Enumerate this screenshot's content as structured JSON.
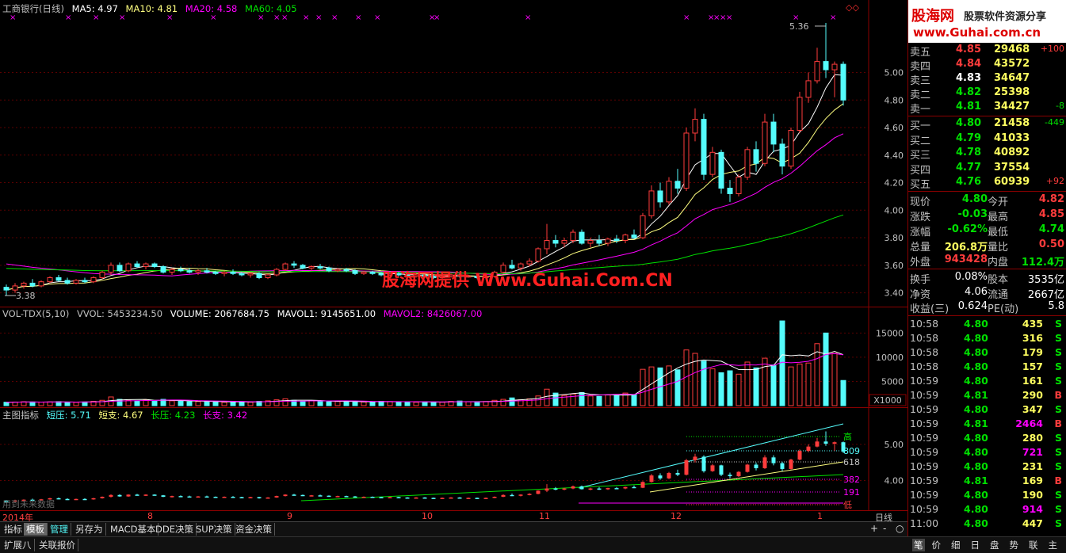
{
  "header": {
    "title": "工商银行(日线)",
    "ma5": "MA5: 4.97",
    "ma10": "MA10: 4.81",
    "ma20": "MA20: 4.58",
    "ma60": "MA60: 4.05"
  },
  "main_chart": {
    "high_label": "5.36",
    "low_label": "3.38",
    "y_ticks": [
      "5.00",
      "4.80",
      "4.60",
      "4.40",
      "4.20",
      "4.00",
      "3.80",
      "3.60",
      "3.40"
    ],
    "watermark": "股海网提供 Www.Guhai.Com.CN"
  },
  "vol_header": {
    "name": "VOL-TDX(5,10)",
    "vvol": "VVOL: 5453234.50",
    "volume": "VOLUME: 2067684.75",
    "mavol1": "MAVOL1: 9145651.00",
    "mavol2": "MAVOL2: 8426067.00"
  },
  "vol_axis": {
    "ticks": [
      "15000",
      "10000",
      "5000"
    ],
    "unit": "X1000"
  },
  "ind_header": {
    "name": "主图指标",
    "short_press": "短压: 5.71",
    "short_support": "短支: 4.67",
    "long_press": "长压: 4.23",
    "long_support": "长支: 3.42"
  },
  "ind_axis": {
    "ticks": [
      "5.00",
      "4.00"
    ],
    "labels": [
      "高",
      "809",
      "618",
      "382",
      "191",
      "低"
    ]
  },
  "ind_note": "用到未来数据",
  "date_axis": {
    "year": "2014年",
    "months": [
      "8",
      "9",
      "10",
      "11",
      "12",
      "1"
    ]
  },
  "period": "日线",
  "tabs": [
    "指标",
    "模板",
    "管理",
    "另存为",
    "MACD基本",
    "DDE决策",
    "SUP决策",
    "资金决策"
  ],
  "tabs2": [
    "扩展八",
    "关联报价"
  ],
  "logo": {
    "name": "股海网",
    "slogan": "股票软件资源分享",
    "url": "www.Guhai.com.cn"
  },
  "order_book": {
    "sell": [
      {
        "label": "卖五",
        "price": "4.85",
        "vol": "29468",
        "chg": "+100"
      },
      {
        "label": "卖四",
        "price": "4.84",
        "vol": "43572",
        "chg": ""
      },
      {
        "label": "卖三",
        "price": "4.83",
        "vol": "34647",
        "chg": ""
      },
      {
        "label": "卖二",
        "price": "4.82",
        "vol": "25398",
        "chg": ""
      },
      {
        "label": "卖一",
        "price": "4.81",
        "vol": "34427",
        "chg": "-8"
      }
    ],
    "buy": [
      {
        "label": "买一",
        "price": "4.80",
        "vol": "21458",
        "chg": "-449"
      },
      {
        "label": "买二",
        "price": "4.79",
        "vol": "41033",
        "chg": ""
      },
      {
        "label": "买三",
        "price": "4.78",
        "vol": "40892",
        "chg": ""
      },
      {
        "label": "买四",
        "price": "4.77",
        "vol": "37554",
        "chg": ""
      },
      {
        "label": "买五",
        "price": "4.76",
        "vol": "60939",
        "chg": "+92"
      }
    ]
  },
  "stats": [
    {
      "l1": "现价",
      "v1": "4.80",
      "l2": "今开",
      "v2": "4.82"
    },
    {
      "l1": "涨跌",
      "v1": "-0.03",
      "l2": "最高",
      "v2": "4.85"
    },
    {
      "l1": "涨幅",
      "v1": "-0.62%",
      "l2": "最低",
      "v2": "4.74"
    },
    {
      "l1": "总量",
      "v1": "206.8万",
      "l2": "量比",
      "v2": "0.50"
    },
    {
      "l1": "外盘",
      "v1": "943428",
      "l2": "内盘",
      "v2": "112.4万"
    }
  ],
  "fund": [
    {
      "l1": "换手",
      "v1": "0.08%",
      "l2": "股本",
      "v2": "3535亿"
    },
    {
      "l1": "净资",
      "v1": "4.06",
      "l2": "流通",
      "v2": "2667亿"
    },
    {
      "l1": "收益(三)",
      "v1": "0.624",
      "l2": "PE(动)",
      "v2": "5.8"
    }
  ],
  "ticks": [
    {
      "t": "10:58",
      "p": "4.80",
      "v": "435",
      "s": "S"
    },
    {
      "t": "10:58",
      "p": "4.80",
      "v": "316",
      "s": "S"
    },
    {
      "t": "10:58",
      "p": "4.80",
      "v": "179",
      "s": "S"
    },
    {
      "t": "10:58",
      "p": "4.80",
      "v": "157",
      "s": "S"
    },
    {
      "t": "10:59",
      "p": "4.80",
      "v": "161",
      "s": "S"
    },
    {
      "t": "10:59",
      "p": "4.81",
      "v": "290",
      "s": "B"
    },
    {
      "t": "10:59",
      "p": "4.80",
      "v": "347",
      "s": "S"
    },
    {
      "t": "10:59",
      "p": "4.81",
      "v": "2464",
      "s": "B"
    },
    {
      "t": "10:59",
      "p": "4.80",
      "v": "280",
      "s": "S"
    },
    {
      "t": "10:59",
      "p": "4.80",
      "v": "721",
      "s": "S"
    },
    {
      "t": "10:59",
      "p": "4.80",
      "v": "231",
      "s": "S"
    },
    {
      "t": "10:59",
      "p": "4.81",
      "v": "169",
      "s": "B"
    },
    {
      "t": "10:59",
      "p": "4.80",
      "v": "190",
      "s": "S"
    },
    {
      "t": "10:59",
      "p": "4.80",
      "v": "914",
      "s": "S"
    },
    {
      "t": "11:00",
      "p": "4.80",
      "v": "447",
      "s": "S"
    }
  ],
  "right_tabs": [
    "笔",
    "价",
    "细",
    "日",
    "盘",
    "势",
    "联",
    "主"
  ],
  "colors": {
    "up": "#ff3c3c",
    "down": "#54fcfc",
    "ma5": "#ffffff",
    "ma10": "#ffff80",
    "ma20": "#ff00ff",
    "ma60": "#00e000"
  },
  "chart_data": {
    "type": "candlestick",
    "ylim": [
      3.34,
      5.4
    ],
    "candles": [
      [
        3.44,
        3.46,
        3.38,
        3.42
      ],
      [
        3.42,
        3.47,
        3.4,
        3.45
      ],
      [
        3.45,
        3.48,
        3.43,
        3.47
      ],
      [
        3.47,
        3.5,
        3.44,
        3.45
      ],
      [
        3.45,
        3.49,
        3.44,
        3.48
      ],
      [
        3.48,
        3.52,
        3.47,
        3.51
      ],
      [
        3.51,
        3.53,
        3.48,
        3.49
      ],
      [
        3.49,
        3.51,
        3.46,
        3.47
      ],
      [
        3.47,
        3.5,
        3.46,
        3.49
      ],
      [
        3.49,
        3.51,
        3.47,
        3.48
      ],
      [
        3.48,
        3.52,
        3.47,
        3.51
      ],
      [
        3.51,
        3.56,
        3.5,
        3.55
      ],
      [
        3.55,
        3.62,
        3.53,
        3.6
      ],
      [
        3.6,
        3.62,
        3.55,
        3.56
      ],
      [
        3.56,
        3.62,
        3.55,
        3.61
      ],
      [
        3.61,
        3.63,
        3.58,
        3.59
      ],
      [
        3.59,
        3.62,
        3.57,
        3.61
      ],
      [
        3.61,
        3.62,
        3.58,
        3.59
      ],
      [
        3.59,
        3.6,
        3.54,
        3.55
      ],
      [
        3.55,
        3.58,
        3.53,
        3.57
      ],
      [
        3.57,
        3.59,
        3.55,
        3.56
      ],
      [
        3.56,
        3.58,
        3.54,
        3.55
      ],
      [
        3.55,
        3.57,
        3.53,
        3.56
      ],
      [
        3.56,
        3.58,
        3.54,
        3.55
      ],
      [
        3.55,
        3.56,
        3.53,
        3.54
      ],
      [
        3.54,
        3.56,
        3.52,
        3.55
      ],
      [
        3.55,
        3.57,
        3.53,
        3.54
      ],
      [
        3.54,
        3.55,
        3.52,
        3.53
      ],
      [
        3.53,
        3.55,
        3.51,
        3.54
      ],
      [
        3.54,
        3.55,
        3.5,
        3.51
      ],
      [
        3.51,
        3.54,
        3.5,
        3.53
      ],
      [
        3.53,
        3.58,
        3.52,
        3.57
      ],
      [
        3.57,
        3.62,
        3.56,
        3.61
      ],
      [
        3.61,
        3.63,
        3.58,
        3.6
      ],
      [
        3.6,
        3.61,
        3.57,
        3.58
      ],
      [
        3.58,
        3.6,
        3.56,
        3.59
      ],
      [
        3.59,
        3.61,
        3.57,
        3.58
      ],
      [
        3.58,
        3.59,
        3.55,
        3.56
      ],
      [
        3.56,
        3.58,
        3.55,
        3.57
      ],
      [
        3.57,
        3.58,
        3.55,
        3.56
      ],
      [
        3.56,
        3.57,
        3.53,
        3.54
      ],
      [
        3.54,
        3.56,
        3.53,
        3.55
      ],
      [
        3.55,
        3.56,
        3.53,
        3.54
      ],
      [
        3.54,
        3.55,
        3.52,
        3.53
      ],
      [
        3.53,
        3.55,
        3.52,
        3.54
      ],
      [
        3.54,
        3.55,
        3.52,
        3.53
      ],
      [
        3.53,
        3.54,
        3.51,
        3.52
      ],
      [
        3.52,
        3.54,
        3.51,
        3.53
      ],
      [
        3.53,
        3.54,
        3.51,
        3.52
      ],
      [
        3.52,
        3.53,
        3.5,
        3.51
      ],
      [
        3.51,
        3.53,
        3.5,
        3.52
      ],
      [
        3.52,
        3.54,
        3.51,
        3.53
      ],
      [
        3.53,
        3.54,
        3.51,
        3.52
      ],
      [
        3.52,
        3.53,
        3.51,
        3.52
      ],
      [
        3.52,
        3.53,
        3.5,
        3.51
      ],
      [
        3.51,
        3.53,
        3.5,
        3.52
      ],
      [
        3.52,
        3.56,
        3.51,
        3.55
      ],
      [
        3.55,
        3.62,
        3.54,
        3.6
      ],
      [
        3.6,
        3.64,
        3.57,
        3.58
      ],
      [
        3.58,
        3.62,
        3.56,
        3.61
      ],
      [
        3.61,
        3.65,
        3.59,
        3.63
      ],
      [
        3.63,
        3.73,
        3.62,
        3.72
      ],
      [
        3.72,
        3.9,
        3.68,
        3.78
      ],
      [
        3.78,
        3.82,
        3.73,
        3.76
      ],
      [
        3.76,
        3.8,
        3.73,
        3.78
      ],
      [
        3.78,
        3.86,
        3.76,
        3.84
      ],
      [
        3.84,
        3.86,
        3.75,
        3.76
      ],
      [
        3.76,
        3.8,
        3.73,
        3.78
      ],
      [
        3.78,
        3.82,
        3.74,
        3.76
      ],
      [
        3.76,
        3.8,
        3.74,
        3.79
      ],
      [
        3.79,
        3.82,
        3.76,
        3.78
      ],
      [
        3.78,
        3.83,
        3.76,
        3.82
      ],
      [
        3.82,
        3.86,
        3.79,
        3.8
      ],
      [
        3.8,
        3.98,
        3.79,
        3.96
      ],
      [
        3.96,
        4.18,
        3.94,
        4.14
      ],
      [
        4.14,
        4.2,
        4.02,
        4.06
      ],
      [
        4.06,
        4.24,
        4.04,
        4.21
      ],
      [
        4.21,
        4.3,
        4.12,
        4.16
      ],
      [
        4.16,
        4.6,
        4.14,
        4.56
      ],
      [
        4.56,
        4.74,
        4.5,
        4.66
      ],
      [
        4.66,
        4.7,
        4.22,
        4.26
      ],
      [
        4.26,
        4.46,
        4.24,
        4.42
      ],
      [
        4.42,
        4.44,
        4.12,
        4.16
      ],
      [
        4.16,
        4.22,
        4.06,
        4.12
      ],
      [
        4.12,
        4.26,
        4.1,
        4.24
      ],
      [
        4.24,
        4.46,
        4.22,
        4.44
      ],
      [
        4.44,
        4.5,
        4.28,
        4.34
      ],
      [
        4.34,
        4.7,
        4.32,
        4.64
      ],
      [
        4.64,
        4.7,
        4.42,
        4.48
      ],
      [
        4.48,
        4.52,
        4.26,
        4.32
      ],
      [
        4.32,
        4.6,
        4.3,
        4.58
      ],
      [
        4.58,
        4.86,
        4.56,
        4.82
      ],
      [
        4.82,
        5.0,
        4.78,
        4.94
      ],
      [
        4.94,
        5.18,
        4.92,
        5.08
      ],
      [
        5.08,
        5.36,
        4.96,
        5.02
      ],
      [
        5.02,
        5.08,
        4.82,
        5.06
      ],
      [
        5.06,
        5.08,
        4.76,
        4.8
      ]
    ],
    "volumes": [
      700,
      750,
      800,
      760,
      720,
      780,
      820,
      700,
      680,
      760,
      900,
      1100,
      1800,
      1300,
      1100,
      1000,
      1200,
      900,
      1300,
      1000,
      900,
      800,
      850,
      900,
      800,
      700,
      750,
      800,
      700,
      900,
      1000,
      1200,
      1400,
      1100,
      900,
      1000,
      900,
      800,
      850,
      900,
      800,
      750,
      800,
      900,
      850,
      800,
      750,
      700,
      800,
      750,
      700,
      900,
      950,
      800,
      700,
      850,
      1100,
      1300,
      1600,
      1200,
      1400,
      2000,
      3400,
      2600,
      2100,
      2400,
      2700,
      2000,
      1900,
      2200,
      2100,
      2600,
      2300,
      7500,
      8000,
      7800,
      8200,
      7400,
      11500,
      10800,
      9200,
      7600,
      6800,
      7200,
      6500,
      9000,
      7800,
      9800,
      8400,
      17500,
      8000,
      8600,
      8800,
      12800,
      15000,
      10800,
      5200
    ],
    "volume_ylim": [
      0,
      18000
    ]
  }
}
